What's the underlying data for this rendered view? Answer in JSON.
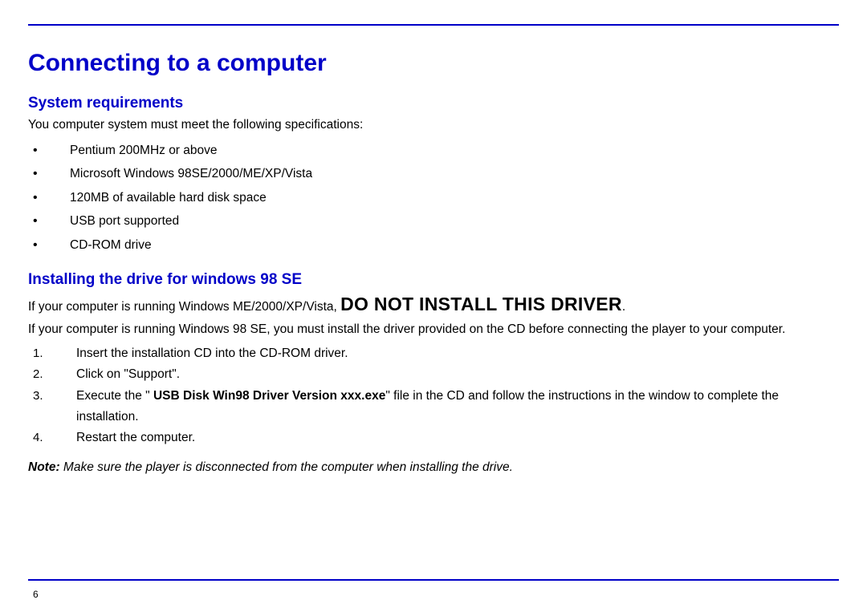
{
  "title": "Connecting to a computer",
  "section1": {
    "heading": "System requirements",
    "intro": "You computer system must meet the following specifications:",
    "items": [
      "Pentium 200MHz or above",
      "Microsoft Windows 98SE/2000/ME/XP/Vista",
      "120MB of available hard disk space",
      "USB port supported",
      "CD-ROM drive"
    ]
  },
  "section2": {
    "heading": "Installing the drive for windows 98 SE",
    "warnPrefix": "If your computer is running Windows ME/2000/XP/Vista, ",
    "warnStrong": "DO NOT INSTALL THIS DRIVER",
    "warnSuffix": ".",
    "mustInstall": "If your computer is running Windows 98 SE, you must install the driver provided on the CD before connecting the player to your computer.",
    "steps": {
      "s1": "Insert the installation CD into the CD-ROM driver.",
      "s2": "Click on \"Support\".",
      "s3_pre": "Execute the \" ",
      "s3_bold": "USB Disk Win98 Driver Version xxx.exe",
      "s3_post": "\" file in the CD and follow the instructions in the window to complete the installation.",
      "s4": "Restart the computer."
    },
    "noteLabel": "Note: ",
    "noteBody": "Make sure the player is disconnected from the computer when installing the drive."
  },
  "pageNumber": "6"
}
